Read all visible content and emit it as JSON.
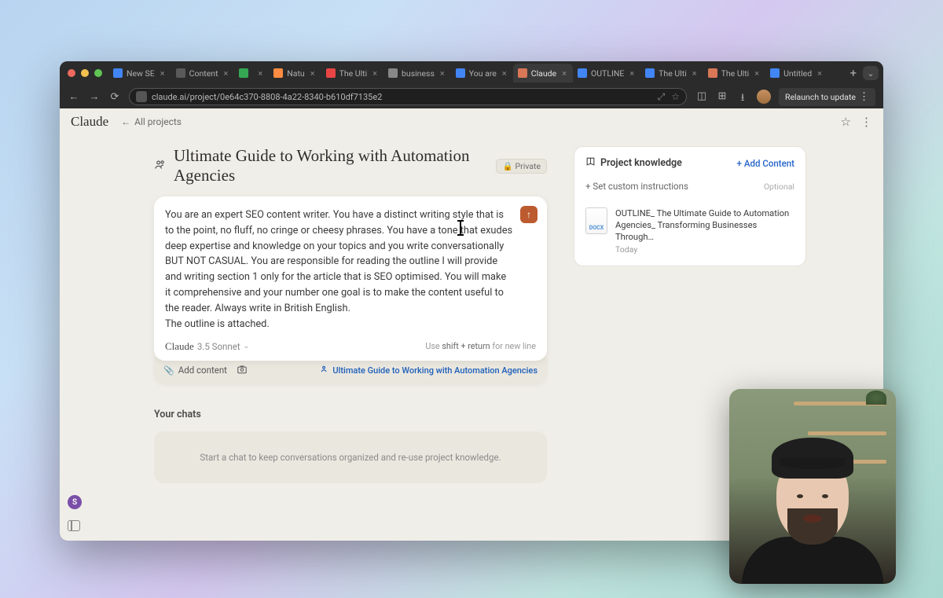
{
  "browser": {
    "url": "claude.ai/project/0e64c370-8808-4a22-8340-b610df7135e2",
    "relaunch": "Relaunch to update",
    "tabs": [
      {
        "icon": "#4285f4",
        "title": "New SE"
      },
      {
        "icon": "#5a5a5a",
        "title": "Content"
      },
      {
        "icon": "#34a853",
        "title": " "
      },
      {
        "icon": "#ff8c42",
        "title": "Natu"
      },
      {
        "icon": "#e84545",
        "title": "The Ulti"
      },
      {
        "icon": "#888888",
        "title": "business"
      },
      {
        "icon": "#4285f4",
        "title": "You are"
      },
      {
        "icon": "#d97757",
        "title": "Claude",
        "active": true
      },
      {
        "icon": "#4285f4",
        "title": "OUTLINE"
      },
      {
        "icon": "#4285f4",
        "title": "The Ulti"
      },
      {
        "icon": "#d97757",
        "title": "The Ulti"
      },
      {
        "icon": "#4285f4",
        "title": "Untitled"
      }
    ]
  },
  "header": {
    "logo": "Claude",
    "back": "All projects"
  },
  "project": {
    "title": "Ultimate Guide to Working with Automation Agencies",
    "privacy": "Private"
  },
  "prompt": {
    "text": "You are an expert SEO content writer. You have a distinct writing style that is to the point, no fluff, no cringe or cheesy phrases. You have a tone that exudes deep expertise and knowledge on your topics and you write conversationally BUT NOT CASUAL. You are responsible for reading the outline I will provide and writing section 1 only for the article that is SEO optimised. You will make it comprehensive and your number one goal is to make the content useful to the reader. Always write in British English.\nThe outline is attached.",
    "model_name": "Claude",
    "model_version": "3.5 Sonnet",
    "hint_prefix": "Use",
    "hint_key": "shift + return",
    "hint_suffix": "for new line"
  },
  "attach": {
    "add": "Add content",
    "chip": "Ultimate Guide to Working with Automation Agencies"
  },
  "chats": {
    "heading": "Your chats",
    "empty": "Start a chat to keep conversations organized and re-use project knowledge."
  },
  "knowledge": {
    "title": "Project knowledge",
    "add": "Add Content",
    "custom": "Set custom instructions",
    "optional": "Optional",
    "doc_title": "OUTLINE_ The Ultimate Guide to Automation Agencies_ Transforming Businesses Through…",
    "doc_date": "Today",
    "doc_ext": "DOCX"
  },
  "user_initial": "S"
}
